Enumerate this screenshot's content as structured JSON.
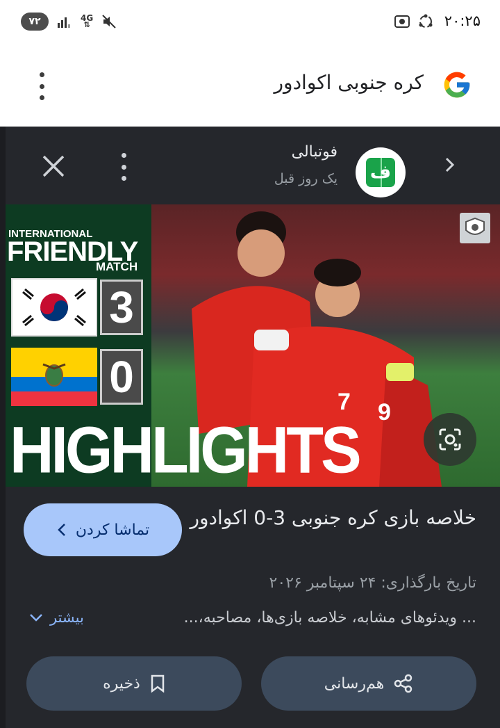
{
  "status_bar": {
    "time": "۲۰:۲۵",
    "battery": "۷۲",
    "network": "4G"
  },
  "search": {
    "query": "کره جنوبی اکوادور"
  },
  "source": {
    "name": "فوتبالی",
    "time_ago": "یک روز قبل",
    "logo_letter": "ف"
  },
  "thumbnail": {
    "line1": "INTERNATIONAL",
    "line2": "FRIENDLY",
    "line3": "MATCH",
    "score_home": "3",
    "score_away": "0",
    "highlights": "HIGHLIGHTS"
  },
  "video": {
    "title": "خلاصه بازی کره جنوبی 3-0 اکوادور",
    "upload_date": "تاریخ بارگذاری: ۲۴ سپتامبر ۲۰۲۶",
    "description": "... ویدئوهای مشابه، خلاصه بازی‌ها، مصاحبه،..."
  },
  "actions": {
    "watch_label": "تماشا کردن",
    "more_label": "بیشتر",
    "save_label": "ذخیره",
    "share_label": "هم‌رسانی"
  },
  "colors": {
    "panel_bg": "#25272c",
    "watch_btn": "#a8c7fa",
    "pill_btn": "#3c4a5c",
    "link": "#8ab4f8"
  }
}
